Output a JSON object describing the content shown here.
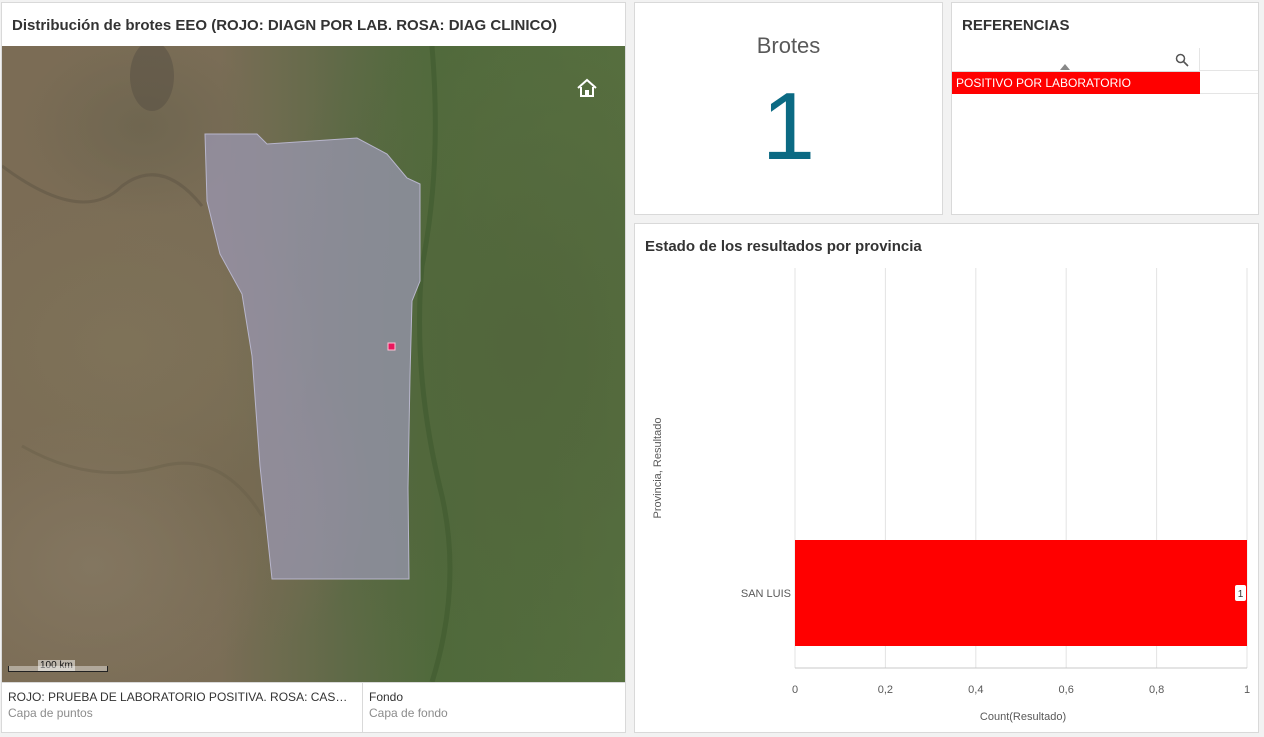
{
  "map_panel": {
    "title": "Distribución de brotes EEO (ROJO: DIAGN POR LAB. ROSA: DIAG CLINICO)",
    "scale_label": "100 km",
    "home_icon": "home-icon",
    "layers": [
      {
        "name": "ROJO: PRUEBA DE LABORATORIO POSITIVA. ROSA: CASO P...",
        "type": "Capa de puntos"
      },
      {
        "name": "Fondo",
        "type": "Capa de fondo"
      }
    ],
    "region_color": "#9b98b4",
    "point_color": "#e8175d"
  },
  "kpi": {
    "label": "Brotes",
    "value": "1",
    "color": "#0b6a83"
  },
  "references": {
    "title": "REFERENCIAS",
    "search_icon": "search-icon",
    "items": [
      {
        "label": "POSITIVO POR LABORATORIO",
        "color": "#ff0000"
      }
    ]
  },
  "chart_panel": {
    "title": "Estado de los resultados por provincia"
  },
  "chart_data": {
    "type": "bar",
    "orientation": "horizontal",
    "categories": [
      "SAN LUIS"
    ],
    "series": [
      {
        "values": [
          1
        ],
        "color": "#ff0000"
      }
    ],
    "data_labels": [
      "1"
    ],
    "xlabel": "Count(Resultado)",
    "ylabel": "Provincia, Resultado",
    "xlim": [
      0,
      1
    ],
    "x_ticks": [
      "0",
      "0,2",
      "0,4",
      "0,6",
      "0,8",
      "1"
    ],
    "grid": true
  }
}
